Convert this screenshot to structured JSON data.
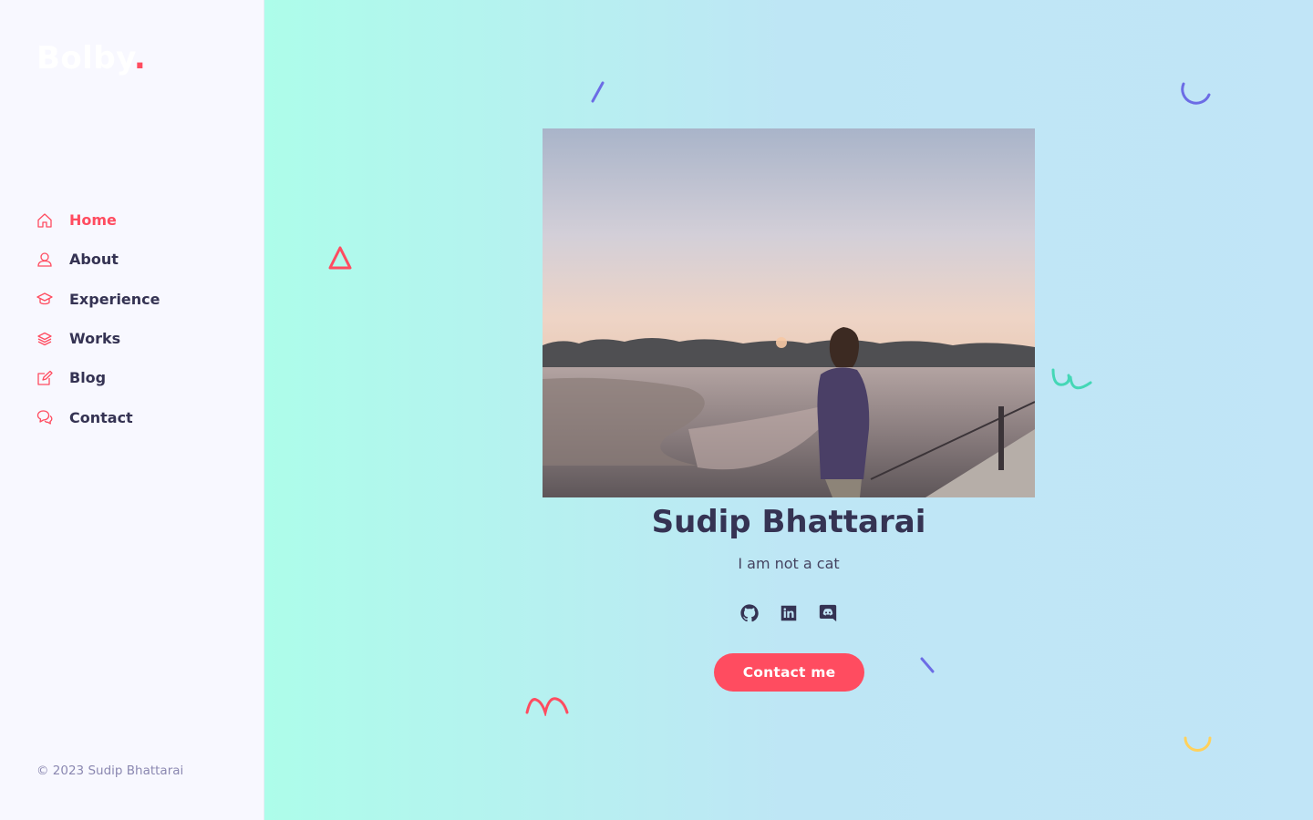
{
  "brand": {
    "logo_text": "Bolby",
    "logo_dot": ".",
    "accent_color": "#ff4c60"
  },
  "nav": {
    "items": [
      {
        "label": "Home",
        "icon": "home-icon",
        "active": true
      },
      {
        "label": "About",
        "icon": "user-icon",
        "active": false
      },
      {
        "label": "Experience",
        "icon": "graduation-cap-icon",
        "active": false
      },
      {
        "label": "Works",
        "icon": "layers-icon",
        "active": false
      },
      {
        "label": "Blog",
        "icon": "note-icon",
        "active": false
      },
      {
        "label": "Contact",
        "icon": "bubbles-icon",
        "active": false
      }
    ]
  },
  "footer": {
    "copyright": "© 2023 Sudip Bhattarai"
  },
  "hero": {
    "name": "Sudip Bhattarai",
    "tagline": "I am not a cat",
    "socials": [
      {
        "icon": "github-icon"
      },
      {
        "icon": "linkedin-icon"
      },
      {
        "icon": "discord-icon"
      }
    ],
    "cta_label": "Contact me"
  },
  "colors": {
    "text_dark": "#353353",
    "gradient_start": "#adfdea",
    "gradient_end": "#c1e5f7"
  }
}
